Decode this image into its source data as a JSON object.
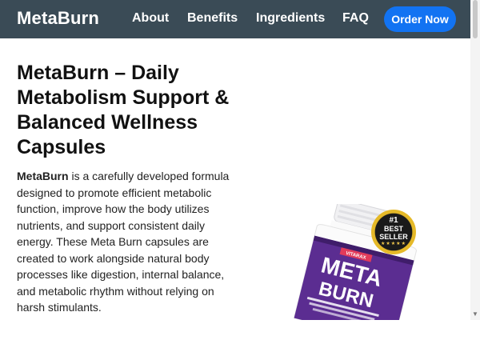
{
  "nav": {
    "brand": "MetaBurn",
    "links": [
      "About",
      "Benefits",
      "Ingredients",
      "FAQ"
    ],
    "cta": "Order Now"
  },
  "hero": {
    "title": "MetaBurn – Daily Metabolism Support & Balanced Wellness Capsules",
    "description_bold": "MetaBurn",
    "description_rest": " is a carefully developed formula designed to promote efficient metabolic function, improve how the body utilizes nutrients, and support consistent daily energy. These Meta Burn capsules are created to work alongside natural body processes like digestion, internal balance, and metabolic rhythm without relying on harsh stimulants."
  },
  "product": {
    "brand_label": "VITARAX",
    "name_line1": "META",
    "name_line2": "BURN",
    "badge_line1": "#1",
    "badge_line2": "BEST",
    "badge_line3": "SELLER",
    "badge_stars": "★★★★★"
  },
  "colors": {
    "navbar": "#3a4b56",
    "cta": "#1273f2",
    "bottle_label": "#5b2d91"
  }
}
